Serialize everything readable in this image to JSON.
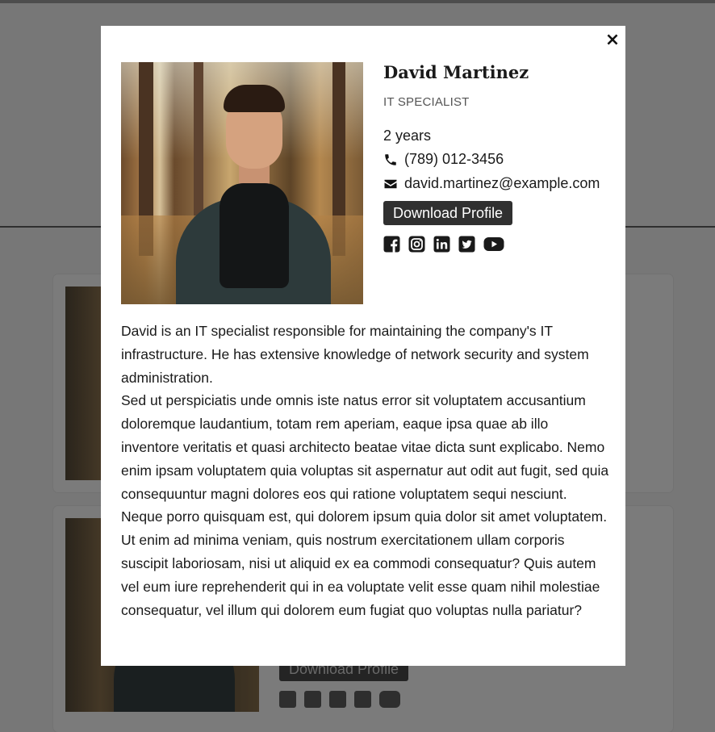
{
  "modal": {
    "close_label": "×",
    "name": "David Martinez",
    "role": "IT SPECIALIST",
    "experience": "2 years",
    "phone": "(789) 012-3456",
    "email": "david.martinez@example.com",
    "download_label": "Download Profile",
    "social": [
      "facebook-icon",
      "instagram-icon",
      "linkedin-icon",
      "twitter-icon",
      "youtube-icon"
    ],
    "bio": [
      "David is an IT specialist responsible for maintaining the company's IT infrastructure. He has extensive knowledge of network security and system administration.",
      "Sed ut perspiciatis unde omnis iste natus error sit voluptatem accusantium doloremque laudantium, totam rem aperiam, eaque ipsa quae ab illo inventore veritatis et quasi architecto beatae vitae dicta sunt explicabo. Nemo enim ipsam voluptatem quia voluptas sit aspernatur aut odit aut fugit, sed quia consequuntur magni dolores eos qui ratione voluptatem sequi nesciunt. Neque porro quisquam est, qui dolorem ipsum quia dolor sit amet voluptatem. Ut enim ad minima veniam, quis nostrum exercitationem ullam corporis suscipit laboriosam, nisi ut aliquid ex ea commodi consequatur? Quis autem vel eum iure reprehenderit qui in ea voluptate velit esse quam nihil molestiae consequatur, vel illum qui dolorem eum fugiat quo voluptas nulla pariatur?"
    ]
  },
  "background": {
    "card2_download_label": "Download Profile"
  },
  "colors": {
    "overlay": "#777777",
    "modal_bg": "#ffffff",
    "button_bg": "#303030",
    "text": "#1a1a1a"
  }
}
